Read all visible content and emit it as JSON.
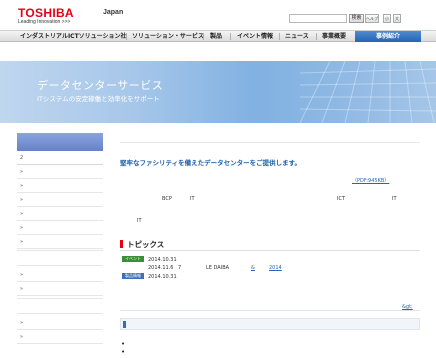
{
  "header": {
    "brand": "TOSHIBA",
    "tagline": "Leading Innovation >>>",
    "region": "Japan",
    "search_button": "検索",
    "help_button": "ヘルプ",
    "text_small": "小",
    "text_large": "大"
  },
  "nav": {
    "items": [
      {
        "label": "インダストリアルICTソリューション社"
      },
      {
        "label": "ソリューション・サービス"
      },
      {
        "label": "製品"
      },
      {
        "label": "イベント情報"
      },
      {
        "label": "ニュース"
      },
      {
        "label": "事業概要"
      },
      {
        "label": "事例紹介"
      }
    ],
    "active_index": 6
  },
  "hero": {
    "title": "データセンターサービス",
    "subtitle": "ITシステムの安定稼働と効率化をサポート"
  },
  "sidebar": {
    "items": [
      {
        "label": "2"
      },
      {
        "label": "»"
      },
      {
        "label": "»"
      },
      {
        "label": "»"
      },
      {
        "label": "»"
      },
      {
        "label": "»"
      },
      {
        "label": "»"
      },
      {
        "label": "»"
      },
      {
        "label": "»"
      },
      {
        "label": "»"
      },
      {
        "label": "»"
      }
    ]
  },
  "content": {
    "lead": "堅牢なファシリティを備えたデータセンターをご提供します。",
    "pdf_link": "（PDF:945KB）",
    "body_tokens": [
      "BCP",
      "IT",
      "ICT",
      "IT",
      "IT"
    ]
  },
  "topics": {
    "title": "トピックス",
    "items": [
      {
        "badge": "イベント",
        "date": "2014.10.31",
        "text": "",
        "link": ""
      },
      {
        "badge": "",
        "date": "2014.11.6",
        "text": "7",
        "text2": "LE DAIBA",
        "link": "&",
        "link2": "2014"
      },
      {
        "badge": "製品情報",
        "date": "2014.10.31",
        "text": "",
        "link": ""
      }
    ],
    "more": "&gt;"
  },
  "colors": {
    "brand_red": "#e60012",
    "link_blue": "#2a62b8",
    "nav_active": "#2464b4"
  }
}
